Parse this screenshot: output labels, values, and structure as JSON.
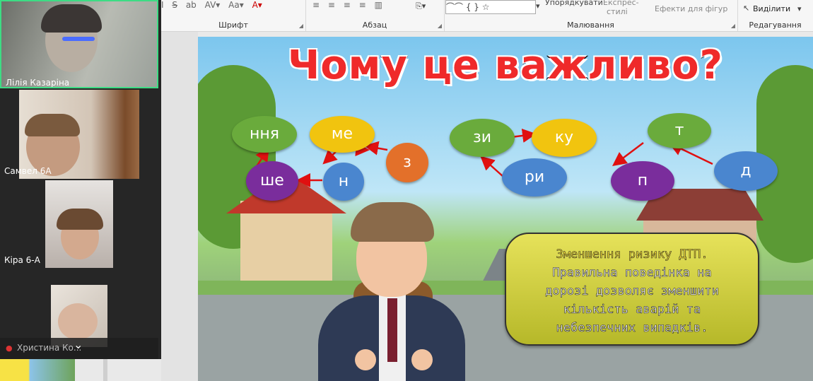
{
  "ribbon": {
    "font_group_label": "Шрифт",
    "paragraph_group_label": "Абзац",
    "drawing_group_label": "Малювання",
    "editing_group_label": "Редагування",
    "arrange_label": "Упорядкувати",
    "quick_styles_label": "Експрес-",
    "quick_styles_label2": "стилі",
    "shape_effects_label": "Ефекти для фігур",
    "select_label": "Виділити"
  },
  "participants": [
    {
      "name": "Лілія Казаріна",
      "active": true
    },
    {
      "name": "Самвел 6А",
      "active": false
    },
    {
      "name": "Кіра 6-А",
      "active": false
    },
    {
      "name": "Христина Ко...",
      "active": false
    }
  ],
  "slide": {
    "title": "Чому це важливо?",
    "puzzle1": [
      "ння",
      "ме",
      "з",
      "ше",
      "н"
    ],
    "puzzle2": [
      "зи",
      "ку",
      "ри"
    ],
    "puzzle3": [
      "т",
      "п",
      "д"
    ],
    "info_lines": [
      "Зменшення ризику ДТП.",
      "Правильна поведінка на",
      "дорозі дозволяє зменшити",
      "кількість аварій та",
      "небезпечних випадків."
    ]
  },
  "colors": {
    "title_red": "#ef2a2a",
    "bubble_green": "#6aab3c",
    "bubble_yellow": "#f1c40f",
    "bubble_purple": "#7a2d9c",
    "bubble_blue": "#4a86cf",
    "bubble_orange": "#e3702a",
    "info_box": "#d4d240",
    "active_speaker_border": "#3ddc84"
  }
}
